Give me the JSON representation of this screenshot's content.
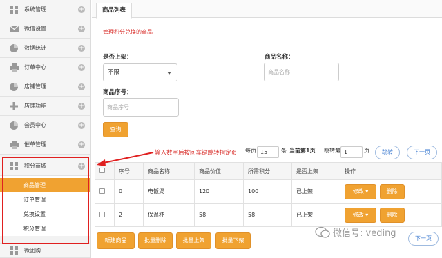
{
  "sidebar": {
    "items": [
      {
        "label": "系统管理",
        "icon": "grid-icon"
      },
      {
        "label": "微信设置",
        "icon": "mail-icon"
      },
      {
        "label": "数据统计",
        "icon": "pie-chart-icon"
      },
      {
        "label": "订单中心",
        "icon": "printer-icon"
      },
      {
        "label": "店铺管理",
        "icon": "pie-chart-icon"
      },
      {
        "label": "店铺功能",
        "icon": "plus-cross-icon"
      },
      {
        "label": "会员中心",
        "icon": "pie-chart-icon"
      },
      {
        "label": "催单管理",
        "icon": "printer-icon"
      },
      {
        "label": "积分商城",
        "icon": "grid-icon"
      }
    ],
    "sub_items": [
      "商品管理",
      "订单管理",
      "兑换设置",
      "积分管理"
    ],
    "last_item": {
      "label": "微团购",
      "icon": "grid-icon"
    },
    "expand_glyph": "+"
  },
  "tab": {
    "label": "商品列表"
  },
  "hint": "管理积分兑换的商品",
  "filters": {
    "status_label": "是否上架：",
    "status_value": "不限",
    "name_label": "商品名称：",
    "name_placeholder": "商品名称",
    "code_label": "商品序号：",
    "code_placeholder": "商品序号",
    "query_button": "查询"
  },
  "annotation": "输入数字后按回车键跳转指定页",
  "pager": {
    "per_page_prefix": "每页",
    "per_page_value": "15",
    "per_page_suffix": "条",
    "current_page": "当前第1页",
    "jump_prefix": "跳转第",
    "jump_value": "1",
    "jump_suffix": "页",
    "jump_button": "跳转",
    "next_button": "下一页"
  },
  "table": {
    "headers": [
      "序号",
      "商品名称",
      "商品价值",
      "所需积分",
      "是否上架",
      "操作"
    ],
    "rows": [
      {
        "seq": "0",
        "name": "电饭煲",
        "value": "120",
        "points": "100",
        "status": "已上架"
      },
      {
        "seq": "2",
        "name": "保温杯",
        "value": "58",
        "points": "58",
        "status": "已上架"
      }
    ],
    "edit_button": "修改",
    "delete_button": "删除"
  },
  "actions": {
    "new": "新建商品",
    "batch_delete": "批量删除",
    "batch_on": "批量上架",
    "batch_off": "批量下架",
    "next_bottom": "下一页"
  },
  "watermark": "微信号: veding",
  "colors": {
    "accent": "#f0a231",
    "annotation_red": "#e02020",
    "link_blue": "#3d7bd0"
  }
}
